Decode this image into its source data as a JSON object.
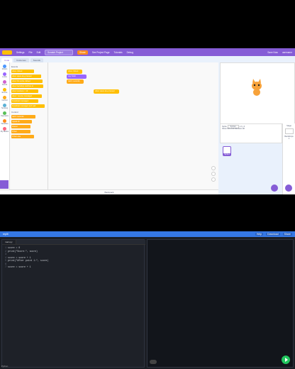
{
  "scratch": {
    "menu": {
      "settings": "Settings",
      "file": "File",
      "edit": "Edit",
      "project_title": "Scratch Project",
      "share": "Share",
      "see_project_page": "See Project Page",
      "tutorials": "Tutorials",
      "debug": "Debug",
      "save_now": "Save Now",
      "user": "username"
    },
    "tabs": [
      "Code",
      "Costumes",
      "Sounds"
    ],
    "categories": [
      {
        "label": "Motion",
        "color": "#4c97ff"
      },
      {
        "label": "Looks",
        "color": "#9966ff"
      },
      {
        "label": "Sound",
        "color": "#cf63cf"
      },
      {
        "label": "Events",
        "color": "#ffbf00"
      },
      {
        "label": "Control",
        "color": "#ffab19"
      },
      {
        "label": "Sensing",
        "color": "#5cb1d6"
      },
      {
        "label": "Operators",
        "color": "#59c059"
      },
      {
        "label": "Variables",
        "color": "#ff8c1a"
      },
      {
        "label": "My Blocks",
        "color": "#ff6680"
      }
    ],
    "palette": {
      "events_header": "Events",
      "events_blocks": [
        "when clicked",
        "when space key pressed",
        "when this sprite clicked",
        "when backdrop switches to",
        "when loudness > 10",
        "when I receive message1",
        "broadcast message1",
        "broadcast message1 and wait"
      ],
      "control_header": "Control",
      "control_blocks": [
        "wait 1 seconds",
        "repeat 10",
        "forever",
        "if then",
        "if then else"
      ]
    },
    "code_blocks": [
      "when clicked",
      "say Hello!",
      "wait 1 seconds",
      "when space key pressed"
    ],
    "sprite_info": {
      "sprite_label": "Sprite",
      "sprite_name": "Sprite1",
      "x": "0",
      "y": "0",
      "show_label": "Show",
      "size_label": "Size",
      "size": "100",
      "direction_label": "Direction",
      "direction": "90"
    },
    "sprite_thumb_label": "Sprite1",
    "stage_label": "Stage",
    "backdrops_label": "Backdrops",
    "backdrops_count": "1",
    "backpack": "Backpack"
  },
  "editor": {
    "title": "replit",
    "buttons": [
      "Help",
      "Download",
      "Share"
    ],
    "file_tab": "main.py",
    "code_lines": [
      {
        "n": "1",
        "t": "score = 0"
      },
      {
        "n": "2",
        "t": "print(\"Score:\", score)"
      },
      {
        "n": "3",
        "t": ""
      },
      {
        "n": "4",
        "t": "score = score + 1"
      },
      {
        "n": "5",
        "t": "print(\"After point 1:\", score)"
      },
      {
        "n": "6",
        "t": ""
      },
      {
        "n": "7",
        "t": "score = score + 1"
      }
    ],
    "status": "Python"
  }
}
